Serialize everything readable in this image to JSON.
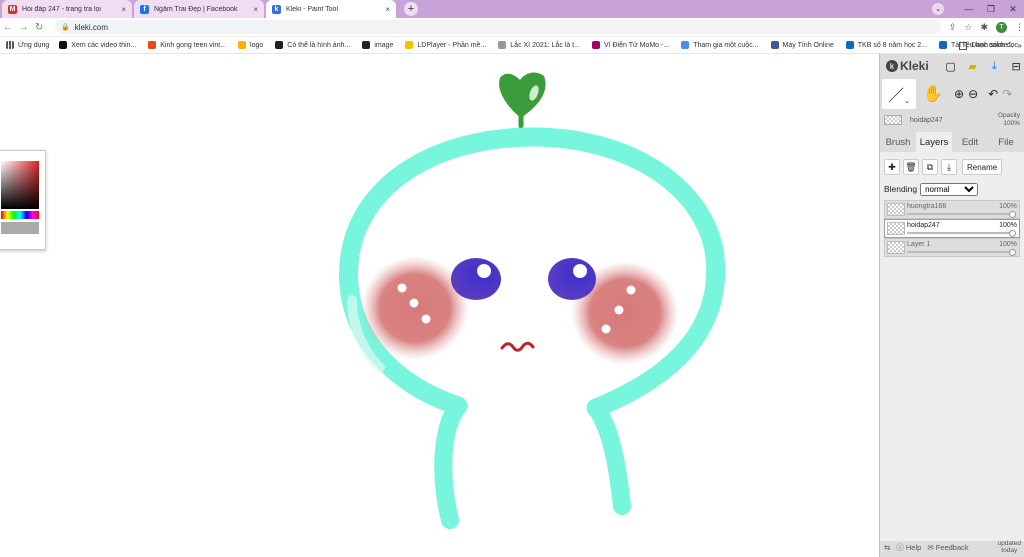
{
  "browser": {
    "tabs": [
      {
        "title": "Hỏi đáp 247 - trang tra lọi",
        "favicon": "gmail-icon",
        "active": false
      },
      {
        "title": "Ngắm Trai Đẹp | Facebook",
        "favicon": "facebook-icon",
        "active": false
      },
      {
        "title": "Kleki - Paint Tool",
        "favicon": "kleki-icon",
        "active": true
      }
    ],
    "new_tab_symbol": "+",
    "tab_close_symbol": "×",
    "url": "kleki.com",
    "profile_initial": "T"
  },
  "bookmarks": {
    "apps_label": "Ứng dụng",
    "items": [
      {
        "label": "Xem các video thin...",
        "icon_color": "#111111"
      },
      {
        "label": "Kinh gong teen vint...",
        "icon_color": "#e64a19"
      },
      {
        "label": "logo",
        "icon_color": "#f4b400"
      },
      {
        "label": "Có thể là hình ảnh...",
        "icon_color": "#222222"
      },
      {
        "label": "image",
        "icon_color": "#222222"
      },
      {
        "label": "LDPlayer - Phần mề...",
        "icon_color": "#f2c200"
      },
      {
        "label": "Lắc Xì 2021: Lắc là t...",
        "icon_color": "#999999"
      },
      {
        "label": "Ví Điện Tử MoMo -...",
        "icon_color": "#a50064"
      },
      {
        "label": "Tham gia một cuộc...",
        "icon_color": "#4a90e2"
      },
      {
        "label": "Máy Tính Online",
        "icon_color": "#3b5998"
      },
      {
        "label": "TKB số 8 năm học 2...",
        "icon_color": "#1565c0"
      },
      {
        "label": "Tài liệu học online...",
        "icon_color": "#1565c0"
      }
    ],
    "more_symbol": "»",
    "reading_list_label": "Danh sách đọc"
  },
  "app": {
    "name": "Kleki",
    "layer_name_header": "hoidap247",
    "opacity_label": "Opacity",
    "opacity_value": "100%",
    "tabs": [
      "Brush",
      "Layers",
      "Edit",
      "File"
    ],
    "active_tab": "Layers",
    "rename_label": "Rename",
    "blending_label": "Blending",
    "blending_value": "normal",
    "layers": [
      {
        "name": "huongtra168",
        "opacity": "100%",
        "selected": false
      },
      {
        "name": "hoidap247",
        "opacity": "100%",
        "selected": true
      },
      {
        "name": "Layer 1",
        "opacity": "100%",
        "selected": false
      }
    ],
    "help_label": "Help",
    "feedback_label": "Feedback",
    "updated_label": "updated",
    "updated_value": "today"
  },
  "colors": {
    "tab_strip": "#c8a3d8",
    "body_outline": "#77f5dd",
    "leaf": "#3a9c3a",
    "eyes": "#4a3dc9",
    "cheeks": "#d98080",
    "mouth": "#c0202a"
  }
}
